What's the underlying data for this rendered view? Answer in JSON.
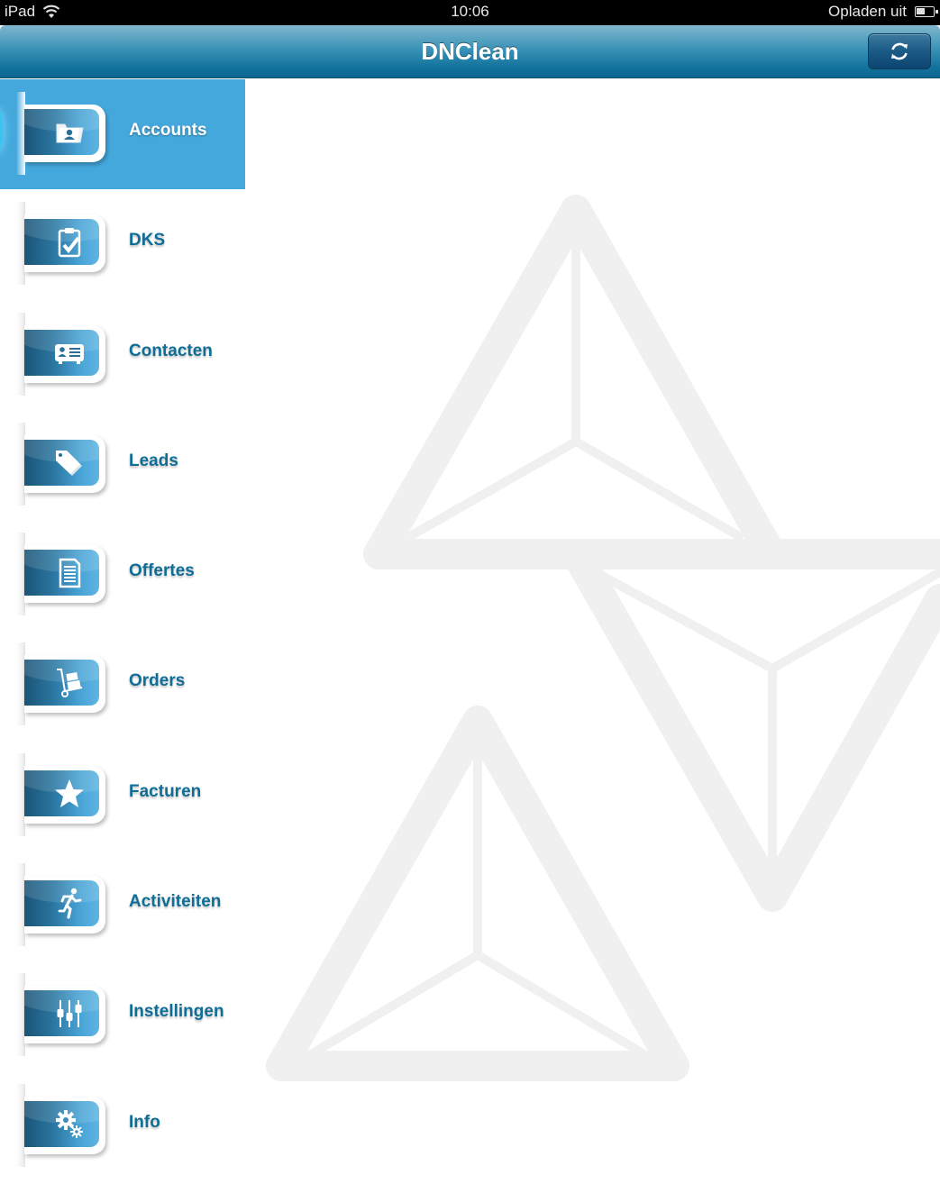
{
  "status_bar": {
    "device": "iPad",
    "time": "10:06",
    "charging_status": "Opladen uit",
    "icons": [
      "wifi-icon",
      "battery-icon"
    ]
  },
  "nav_bar": {
    "title": "DNClean",
    "refresh_button_icon": "refresh-icon"
  },
  "menu": {
    "active_index": 0,
    "items": [
      {
        "label": "Accounts",
        "icon": "folder-user-icon"
      },
      {
        "label": "DKS",
        "icon": "clipboard-check-icon"
      },
      {
        "label": "Contacten",
        "icon": "contact-card-icon"
      },
      {
        "label": "Leads",
        "icon": "tag-icon"
      },
      {
        "label": "Offertes",
        "icon": "document-icon"
      },
      {
        "label": "Orders",
        "icon": "hand-truck-icon"
      },
      {
        "label": "Facturen",
        "icon": "star-icon"
      },
      {
        "label": "Activiteiten",
        "icon": "running-person-icon"
      },
      {
        "label": "Instellingen",
        "icon": "sliders-icon"
      },
      {
        "label": "Info",
        "icon": "gears-icon"
      }
    ]
  },
  "colors": {
    "nav_bar": "#1a7ba6",
    "active_item_bg": "#45a8dc",
    "menu_label": "#0f6d96",
    "background_logo": "#f0f0f0"
  }
}
